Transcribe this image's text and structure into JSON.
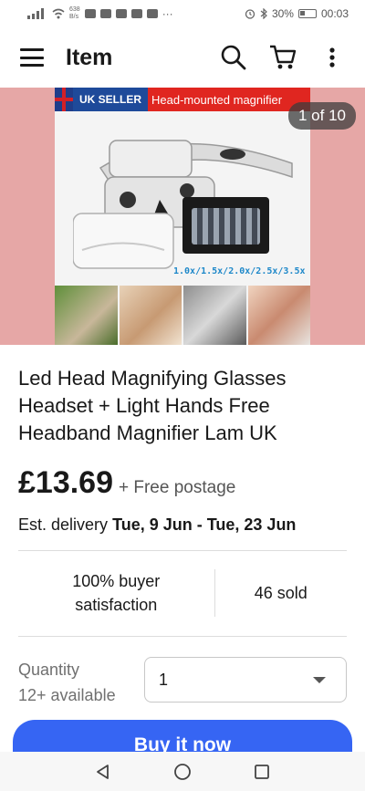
{
  "status_bar": {
    "net_speed_value": "638",
    "net_speed_unit": "B/s",
    "battery": "30%",
    "time": "00:03",
    "overflow": "···"
  },
  "header": {
    "title": "Item"
  },
  "gallery": {
    "counter": "1 of 10",
    "banner_seller": "UK SELLER",
    "banner_text": "Head-mounted magnifier",
    "magnification_text": "1.0x/1.5x/2.0x/2.5x/3.5x",
    "background_color": "#e6a7a6"
  },
  "item": {
    "title": "Led Head Magnifying Glasses Headset + Light Hands Free Headband Magnifier Lam UK",
    "price": "£13.69",
    "postage": "+ Free postage",
    "delivery_prefix": "Est. delivery",
    "delivery_dates": "Tue, 9 Jun - Tue, 23 Jun"
  },
  "stats": {
    "satisfaction": "100% buyer satisfaction",
    "sold": "46 sold"
  },
  "quantity": {
    "label": "Quantity",
    "available": "12+ available",
    "selected": "1"
  },
  "actions": {
    "buy_now": "Buy it now",
    "accent_color": "#3665f3"
  },
  "nav": {
    "icons": [
      "back-icon",
      "home-icon",
      "recents-icon"
    ]
  }
}
